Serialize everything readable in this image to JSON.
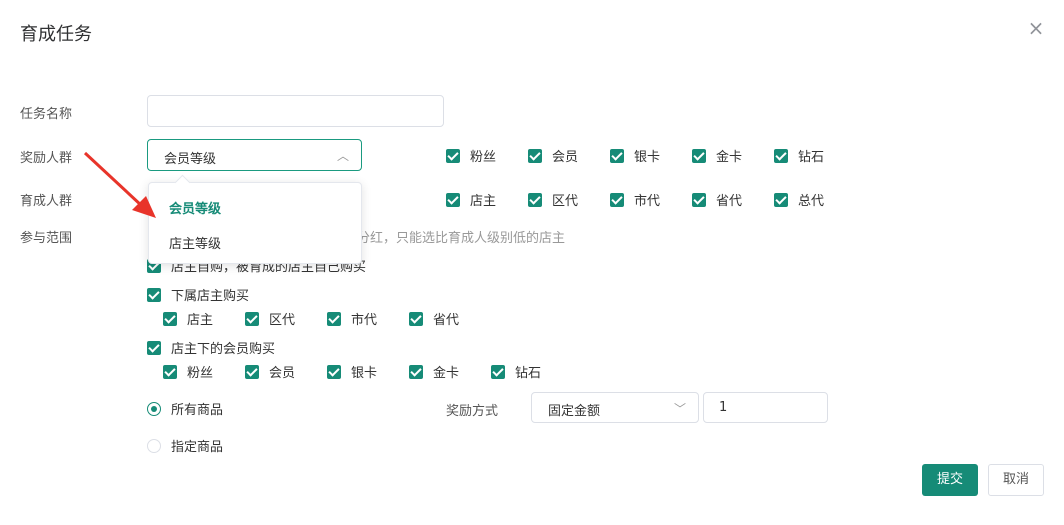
{
  "dialog": {
    "title": "育成任务"
  },
  "form": {
    "task_name_label": "任务名称",
    "task_name_value": "",
    "reward_group_label": "奖励人群",
    "reward_group_select": "会员等级",
    "reward_group_options": [
      "粉丝",
      "会员",
      "银卡",
      "金卡",
      "钻石"
    ],
    "nurture_group_label": "育成人群",
    "nurture_group_options": [
      "店主",
      "区代",
      "市代",
      "省代",
      "总代"
    ],
    "scope_label": "参与范围",
    "scope_hint": "绩分红，只能选比育成人级别低的店主",
    "scope_self_buy": "店主自购，被育成的店主自己购买",
    "scope_sub_shop_buy": "下属店主购买",
    "sub_shop_levels": [
      "店主",
      "区代",
      "市代",
      "省代"
    ],
    "scope_member_buy": "店主下的会员购买",
    "member_levels": [
      "粉丝",
      "会员",
      "银卡",
      "金卡",
      "钻石"
    ],
    "goods_all": "所有商品",
    "goods_specified": "指定商品",
    "reward_method_label": "奖励方式",
    "reward_method_select": "固定金额",
    "reward_amount": "1"
  },
  "dropdown": {
    "items": [
      "会员等级",
      "店主等级"
    ]
  },
  "buttons": {
    "submit": "提交",
    "cancel": "取消"
  },
  "colors": {
    "accent": "#168b77",
    "arrow": "#e8342a"
  }
}
